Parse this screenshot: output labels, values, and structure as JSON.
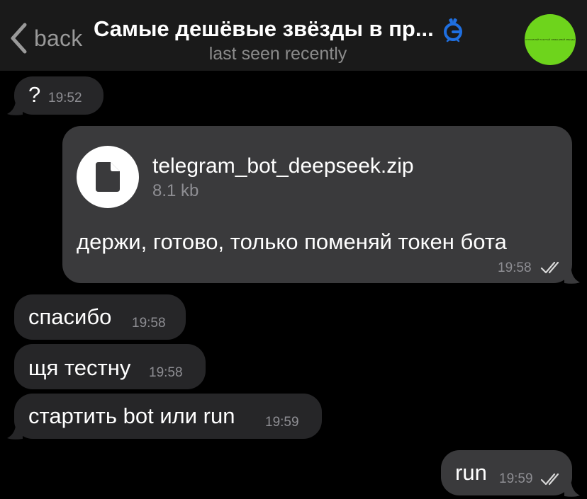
{
  "header": {
    "back_label": "back",
    "title": "Самые дешёвые звёзды в пр...",
    "subtitle": "last seen recently",
    "avatar_text": "ОТПРАВЛЯЙ ПОКУПАЙ ОБМЕНИВАЙ ЗВЕЗДЫ"
  },
  "messages": [
    {
      "direction": "in",
      "text": "?",
      "time": "19:52"
    },
    {
      "direction": "out",
      "type": "file",
      "file_name": "telegram_bot_deepseek.zip",
      "file_size": "8.1 kb",
      "text": "держи, готово, только поменяй токен бота",
      "time": "19:58",
      "status": "read"
    },
    {
      "direction": "in",
      "text": "спасибо",
      "time": "19:58"
    },
    {
      "direction": "in",
      "text": "щя тестну",
      "time": "19:58"
    },
    {
      "direction": "in",
      "text": "стартить bot или run",
      "time": "19:59"
    },
    {
      "direction": "out",
      "text": "run",
      "time": "19:59",
      "status": "read"
    }
  ],
  "colors": {
    "background": "#000000",
    "header": "#1a1a1a",
    "incoming_bubble": "#262628",
    "outgoing_bubble": "#3a3a3c",
    "avatar": "#6ed41c",
    "premium_icon": "#1f6fe0"
  },
  "icons": [
    "chevron-left-icon",
    "premium-gift-icon",
    "document-icon",
    "double-check-icon"
  ]
}
